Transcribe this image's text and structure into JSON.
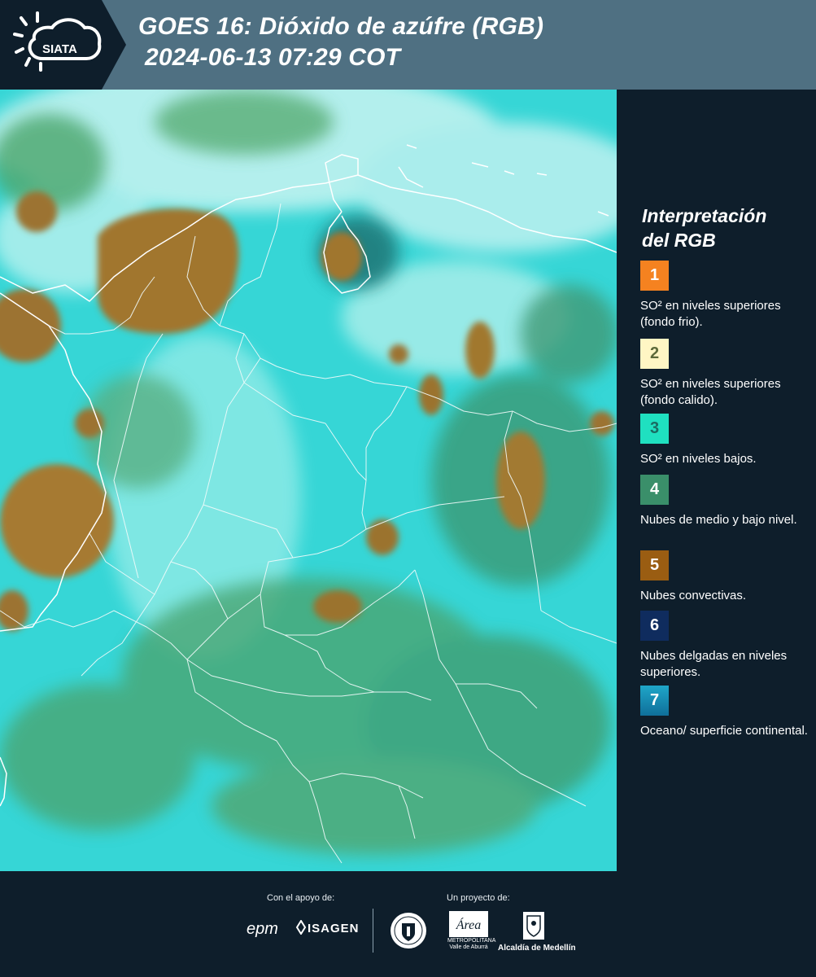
{
  "header": {
    "logo_text": "SIATA",
    "title_line1": "GOES 16: Dióxido de azúfre (RGB)",
    "title_line2": "2024-06-13 07:29 COT"
  },
  "legend": {
    "title_line1": "Interpretación",
    "title_line2": "del RGB",
    "items": [
      {
        "number": "1",
        "color": "#f58220",
        "description": "SO² en niveles superiores (fondo frio)."
      },
      {
        "number": "2",
        "color": "#fff6c4",
        "description": "SO² en niveles superiores (fondo calido)."
      },
      {
        "number": "3",
        "color": "#1fe0c0",
        "description": "SO² en niveles bajos."
      },
      {
        "number": "4",
        "color": "#3a8f6a",
        "description": "Nubes de medio y bajo nivel."
      },
      {
        "number": "5",
        "color": "#9a5d12",
        "description": "Nubes convectivas."
      },
      {
        "number": "6",
        "color": "#0f2c5e",
        "description": "Nubes delgadas en niveles superiores."
      },
      {
        "number": "7",
        "color": "#1a8fb8",
        "description": "Oceano/ superficie continental."
      }
    ]
  },
  "footer": {
    "support_label": "Con el apoyo de:",
    "project_label": "Un proyecto de:",
    "sponsor_1": "epm",
    "sponsor_2": "ISAGEN",
    "partner_area": "METROPOLITANA Valle de Aburrá",
    "partner_area_script": "Área",
    "partner_alcaldia": "Alcaldía de Medellín"
  },
  "icons": [
    "siata-sun-cloud-logo",
    "isagen-logo-icon",
    "medellin-seal-icon",
    "area-metropolitana-logo",
    "alcaldia-shield-icon"
  ]
}
